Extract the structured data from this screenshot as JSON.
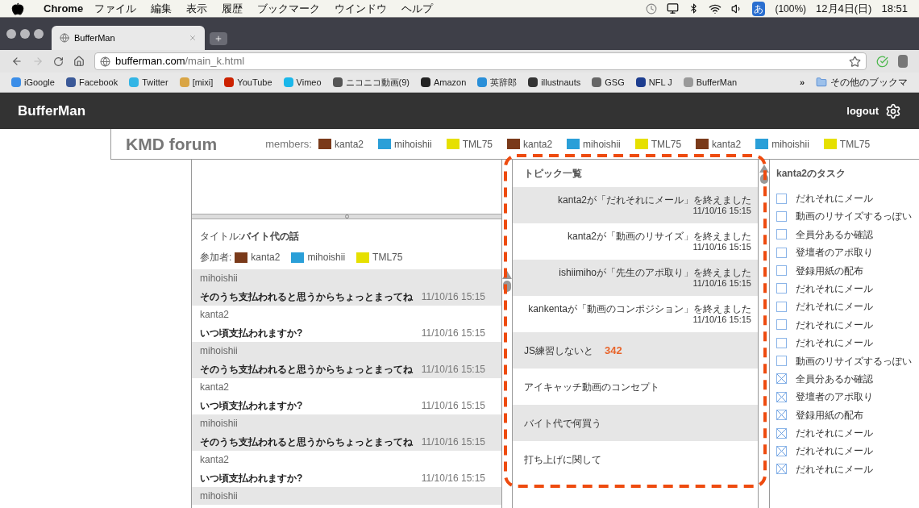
{
  "menubar": {
    "app": "Chrome",
    "menus": [
      "ファイル",
      "編集",
      "表示",
      "履歴",
      "ブックマーク",
      "ウインドウ",
      "ヘルプ"
    ],
    "ime": "あ",
    "battery": "(100%)",
    "date": "12月4日(日)",
    "time": "18:51"
  },
  "browser": {
    "tab_title": "BufferMan",
    "address_domain": "bufferman.com",
    "address_path": "/main_k.html",
    "bookmarks": [
      {
        "label": "iGoogle",
        "color": "#3b8ee8"
      },
      {
        "label": "Facebook",
        "color": "#3b5998"
      },
      {
        "label": "Twitter",
        "color": "#33b5e5"
      },
      {
        "label": "[mixi]",
        "color": "#d9a545"
      },
      {
        "label": "YouTube",
        "color": "#cc2200"
      },
      {
        "label": "Vimeo",
        "color": "#1ab7ea"
      },
      {
        "label": "ニコニコ動画(9)",
        "color": "#555555"
      },
      {
        "label": "Amazon",
        "color": "#222222"
      },
      {
        "label": "英辞郎",
        "color": "#2a8fd8"
      },
      {
        "label": "illustnauts",
        "color": "#333333"
      },
      {
        "label": "GSG",
        "color": "#666666"
      },
      {
        "label": "NFL J",
        "color": "#1d3d8f"
      },
      {
        "label": "BufferMan",
        "color": "#999999"
      }
    ],
    "more": "»",
    "other_bookmarks": "その他のブックマ"
  },
  "app": {
    "title": "BufferMan",
    "logout": "logout"
  },
  "forum": {
    "title": "KMD forum",
    "members_label": "members:",
    "members": [
      {
        "name": "kanta2",
        "color": "#7a3a1a"
      },
      {
        "name": "mihoishii",
        "color": "#2a9fd8"
      },
      {
        "name": "TML75",
        "color": "#e6e000"
      },
      {
        "name": "kanta2",
        "color": "#7a3a1a"
      },
      {
        "name": "mihoishii",
        "color": "#2a9fd8"
      },
      {
        "name": "TML75",
        "color": "#e6e000"
      },
      {
        "name": "kanta2",
        "color": "#7a3a1a"
      },
      {
        "name": "mihoishii",
        "color": "#2a9fd8"
      },
      {
        "name": "TML75",
        "color": "#e6e000"
      }
    ]
  },
  "thread": {
    "title": "タイトル:**バイト代の話**",
    "participants_label": "参加者:",
    "participants": [
      {
        "name": "kanta2",
        "color": "#7a3a1a"
      },
      {
        "name": "mihoishii",
        "color": "#2a9fd8"
      },
      {
        "name": "TML75",
        "color": "#e6e000"
      }
    ],
    "messages": [
      {
        "author": "mihoishii",
        "text": "そのうち支払われると思うからちょっとまってね",
        "time": "11/10/16 15:15"
      },
      {
        "author": "kanta2",
        "text": "いつ頃支払われますか?",
        "time": "11/10/16 15:15"
      },
      {
        "author": "mihoishii",
        "text": "そのうち支払われると思うからちょっとまってね",
        "time": "11/10/16 15:15"
      },
      {
        "author": "kanta2",
        "text": "いつ頃支払われますか?",
        "time": "11/10/16 15:15"
      },
      {
        "author": "mihoishii",
        "text": "そのうち支払われると思うからちょっとまってね",
        "time": "11/10/16 15:15"
      },
      {
        "author": "kanta2",
        "text": "いつ頃支払われますか?",
        "time": "11/10/16 15:15"
      },
      {
        "author": "mihoishii"
      }
    ]
  },
  "topics": {
    "title": "トピック一覧",
    "notifications": [
      {
        "text": "kanta2が「だれそれにメール」を終えました",
        "time": "11/10/16 15:15"
      },
      {
        "text": "kanta2が「動画のリサイズ」を終えました",
        "time": "11/10/16 15:15"
      },
      {
        "text": "ishiimihoが「先生のアポ取り」を終えました",
        "time": "11/10/16 15:15"
      },
      {
        "text": "kankentaが「動画のコンポジション」を終えました",
        "time": "11/10/16 15:15"
      }
    ],
    "items": [
      {
        "title": "JS練習しないと",
        "count": "342"
      },
      {
        "title": "アイキャッチ動画のコンセプト"
      },
      {
        "title": "バイト代で何買う"
      },
      {
        "title": "打ち上げに関して"
      }
    ]
  },
  "tasks": {
    "title": "kanta2のタスク",
    "items": [
      {
        "label": "だれそれにメール",
        "checked": false
      },
      {
        "label": "動画のリサイズするっぽい",
        "checked": false
      },
      {
        "label": "全員分あるか確認",
        "checked": false
      },
      {
        "label": "登壇者のアポ取り",
        "checked": false
      },
      {
        "label": "登録用紙の配布",
        "checked": false
      },
      {
        "label": "だれそれにメール",
        "checked": false
      },
      {
        "label": "だれそれにメール",
        "checked": false
      },
      {
        "label": "だれそれにメール",
        "checked": false
      },
      {
        "label": "だれそれにメール",
        "checked": false
      },
      {
        "label": "動画のリサイズするっぽい",
        "checked": false
      },
      {
        "label": "全員分あるか確認",
        "checked": true
      },
      {
        "label": "登壇者のアポ取り",
        "checked": true
      },
      {
        "label": "登録用紙の配布",
        "checked": true
      },
      {
        "label": "だれそれにメール",
        "checked": true
      },
      {
        "label": "だれそれにメール",
        "checked": true
      },
      {
        "label": "だれそれにメール",
        "checked": true
      }
    ]
  }
}
